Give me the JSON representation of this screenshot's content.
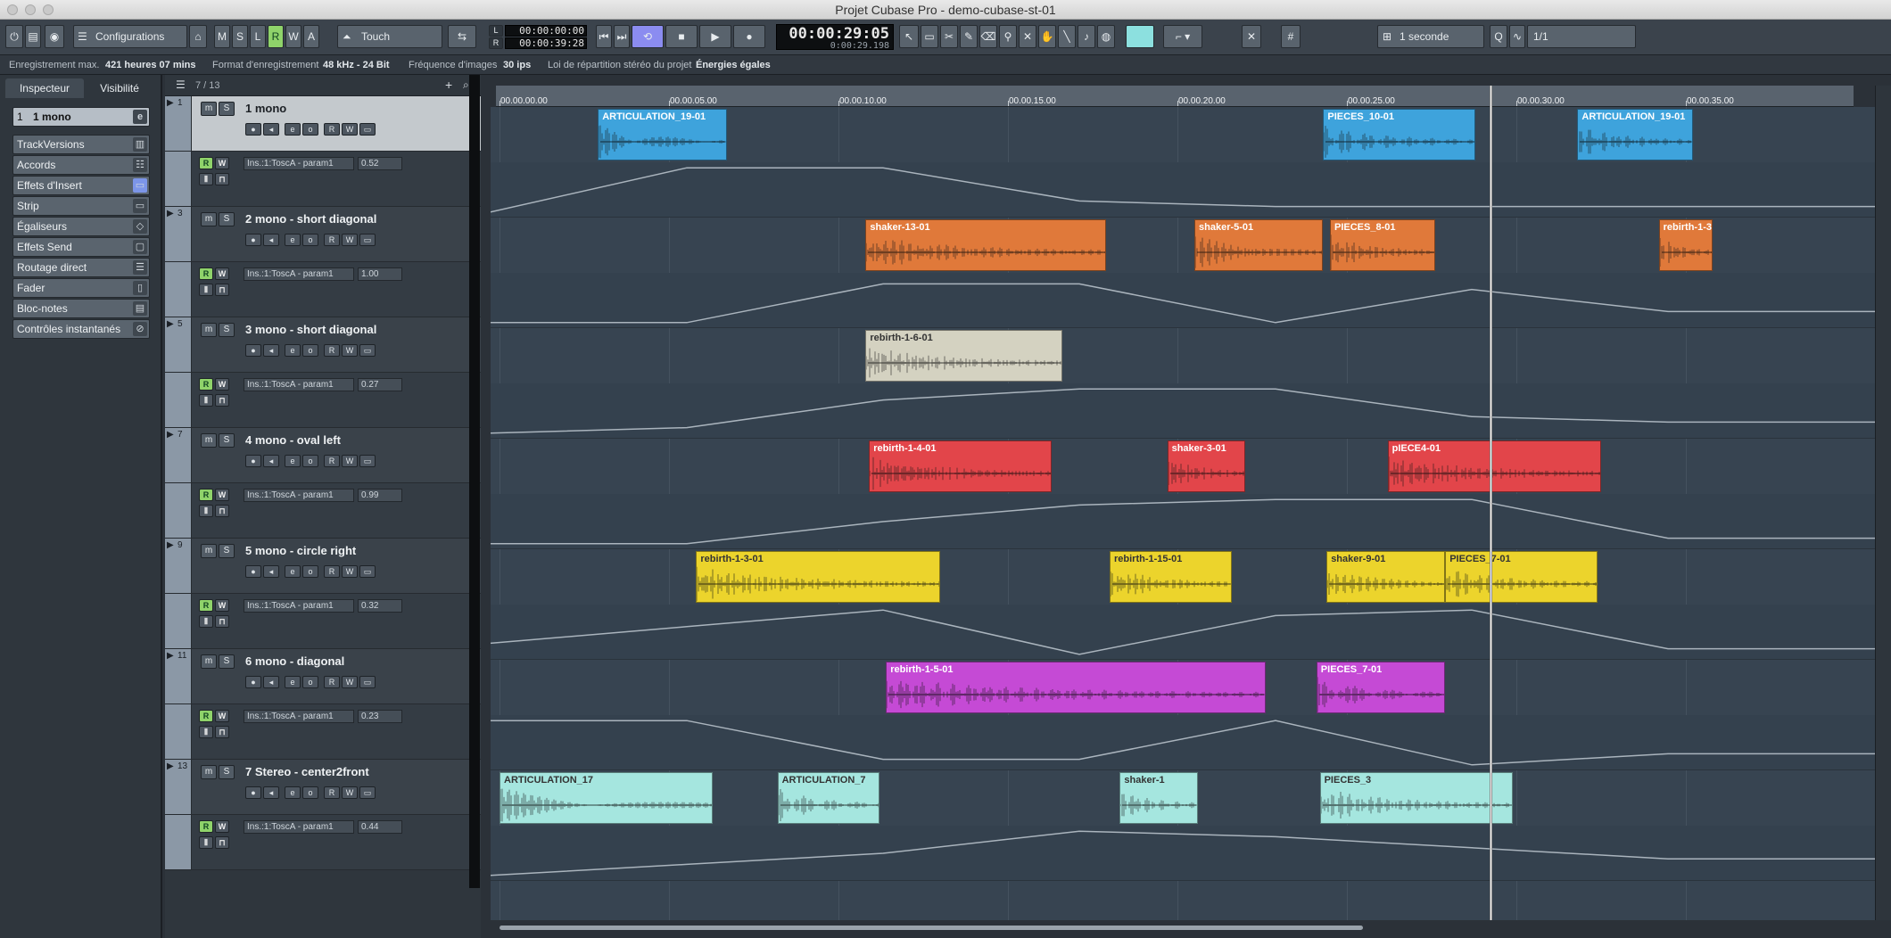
{
  "window": {
    "title": "Projet Cubase Pro - demo-cubase-st-01"
  },
  "toolbar": {
    "configurations": "Configurations",
    "modes": [
      "M",
      "S",
      "L",
      "R",
      "W",
      "A"
    ],
    "automation_mode": "Touch",
    "left_locator": "00:00:00:00",
    "right_locator": "00:00:39:28",
    "time_display": "00:00:29:05",
    "time_sub": "0:00:29.198",
    "grid_label": "1 seconde",
    "quantize_label": "1/1"
  },
  "infoline": {
    "rec_max_label": "Enregistrement max.",
    "rec_max_value": "421 heures 07 mins",
    "format_label": "Format d'enregistrement",
    "format_value": "48 kHz - 24 Bit",
    "fps_label": "Fréquence d'images",
    "fps_value": "30 ips",
    "pan_label": "Loi de répartition stéréo du projet",
    "pan_value": "Énergies égales"
  },
  "inspector": {
    "tabs": [
      "Inspecteur",
      "Visibilité"
    ],
    "track_label": "1 mono",
    "track_num": "1",
    "sections": [
      "TrackVersions",
      "Accords",
      "Effets d'Insert",
      "Strip",
      "Égaliseurs",
      "Effets Send",
      "Routage direct",
      "Fader",
      "Bloc-notes",
      "Contrôles instantanés"
    ]
  },
  "tracklist": {
    "count": "7 / 13",
    "tracks": [
      {
        "num": "1",
        "name": "1 mono",
        "param": "Ins.:1:ToscA - param1",
        "value": "0.52",
        "selected": true
      },
      {
        "num": "3",
        "name": "2 mono - short diagonal",
        "param": "Ins.:1:ToscA - param1",
        "value": "1.00"
      },
      {
        "num": "5",
        "name": "3 mono - short diagonal",
        "param": "Ins.:1:ToscA - param1",
        "value": "0.27"
      },
      {
        "num": "7",
        "name": "4 mono - oval left",
        "param": "Ins.:1:ToscA - param1",
        "value": "0.99"
      },
      {
        "num": "9",
        "name": "5 mono - circle right",
        "param": "Ins.:1:ToscA - param1",
        "value": "0.32"
      },
      {
        "num": "11",
        "name": "6 mono - diagonal",
        "param": "Ins.:1:ToscA - param1",
        "value": "0.23"
      },
      {
        "num": "13",
        "name": "7 Stereo - center2front",
        "param": "Ins.:1:ToscA - param1",
        "value": "0.44"
      }
    ]
  },
  "ruler": {
    "ticks": [
      "00.00.00.00",
      "00.00.05.00",
      "00.00.10.00",
      "00.00.15.00",
      "00.00.20.00",
      "00.00.25.00",
      "00.00.30.00",
      "00.00.35.00"
    ]
  },
  "colors": {
    "blue": "#3ea3dc",
    "orange": "#e0793a",
    "beige": "#d4d2c1",
    "red": "#e2454a",
    "yellow": "#ecd42c",
    "purple": "#c54ad5",
    "cyan": "#a5e6df"
  },
  "clips": [
    {
      "track": 0,
      "name": "ARTICULATION_19-01",
      "color": "blue",
      "start": 2.9,
      "end": 6.7
    },
    {
      "track": 0,
      "name": "PIECES_10-01",
      "color": "blue",
      "start": 24.3,
      "end": 28.8
    },
    {
      "track": 0,
      "name": "ARTICULATION_19-01",
      "color": "blue",
      "start": 31.8,
      "end": 35.2
    },
    {
      "track": 1,
      "name": "shaker-13-01",
      "color": "orange",
      "start": 10.8,
      "end": 17.9
    },
    {
      "track": 1,
      "name": "shaker-5-01",
      "color": "orange",
      "start": 20.5,
      "end": 24.3
    },
    {
      "track": 1,
      "name": "PIECES_8-01",
      "color": "orange",
      "start": 24.5,
      "end": 27.6
    },
    {
      "track": 1,
      "name": "rebirth-1-3",
      "color": "orange",
      "start": 34.2,
      "end": 35.8
    },
    {
      "track": 2,
      "name": "rebirth-1-6-01",
      "color": "beige",
      "start": 10.8,
      "end": 16.6
    },
    {
      "track": 3,
      "name": "rebirth-1-4-01",
      "color": "red",
      "start": 10.9,
      "end": 16.3
    },
    {
      "track": 3,
      "name": "shaker-3-01",
      "color": "red",
      "start": 19.7,
      "end": 22.0
    },
    {
      "track": 3,
      "name": "pIECE4-01",
      "color": "red",
      "start": 26.2,
      "end": 32.5
    },
    {
      "track": 4,
      "name": "rebirth-1-3-01",
      "color": "yellow",
      "start": 5.8,
      "end": 13.0
    },
    {
      "track": 4,
      "name": "rebirth-1-15-01",
      "color": "yellow",
      "start": 18.0,
      "end": 21.6
    },
    {
      "track": 4,
      "name": "shaker-9-01",
      "color": "yellow",
      "start": 24.4,
      "end": 27.9
    },
    {
      "track": 4,
      "name": "PIECES_7-01",
      "color": "yellow",
      "start": 27.9,
      "end": 32.4
    },
    {
      "track": 5,
      "name": "rebirth-1-5-01",
      "color": "purple",
      "start": 11.4,
      "end": 22.6
    },
    {
      "track": 5,
      "name": "PIECES_7-01",
      "color": "purple",
      "start": 24.1,
      "end": 27.9
    },
    {
      "track": 6,
      "name": "ARTICULATION_17",
      "color": "cyan",
      "start": 0.0,
      "end": 6.3
    },
    {
      "track": 6,
      "name": "ARTICULATION_7",
      "color": "cyan",
      "start": 8.2,
      "end": 11.2
    },
    {
      "track": 6,
      "name": "shaker-1",
      "color": "cyan",
      "start": 18.3,
      "end": 20.6
    },
    {
      "track": 6,
      "name": "PIECES_3",
      "color": "cyan",
      "start": 24.2,
      "end": 29.9
    }
  ],
  "playhead_time": 29.2
}
